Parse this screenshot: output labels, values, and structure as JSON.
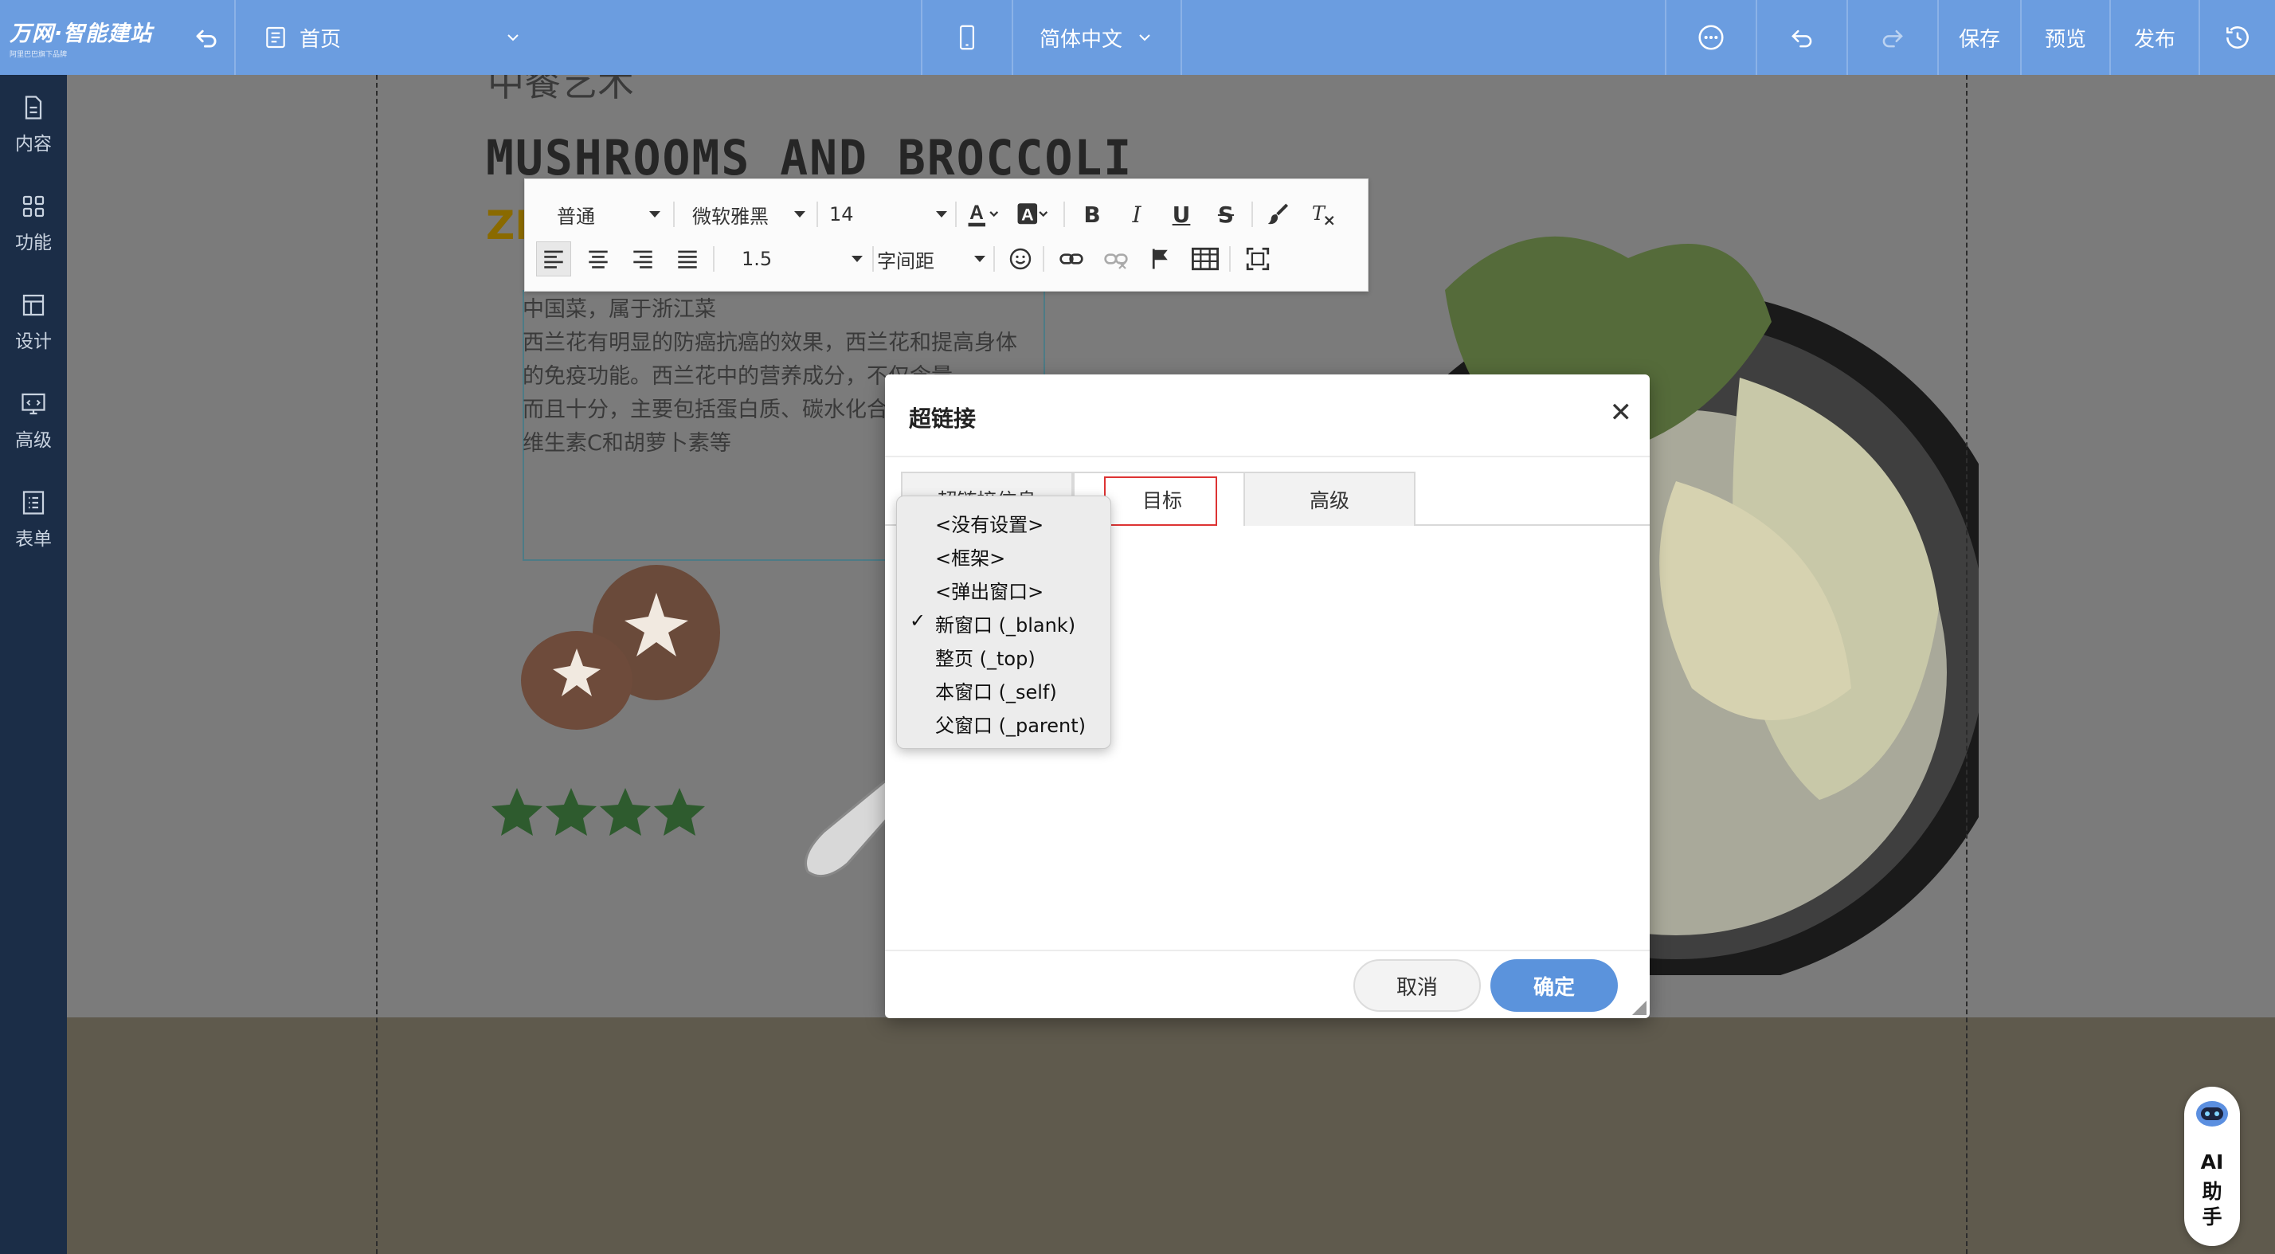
{
  "topbar": {
    "brand": "万网·智能建站",
    "brand_tagline": "阿里巴巴旗下品牌",
    "page_selector": "首页",
    "language": "简体中文",
    "save": "保存",
    "preview": "预览",
    "publish": "发布"
  },
  "sidebar": {
    "items": [
      {
        "label": "内容",
        "icon": "document-icon"
      },
      {
        "label": "功能",
        "icon": "grid-icon"
      },
      {
        "label": "设计",
        "icon": "layout-icon"
      },
      {
        "label": "高级",
        "icon": "code-monitor-icon"
      },
      {
        "label": "表单",
        "icon": "list-form-icon"
      }
    ]
  },
  "canvas": {
    "cuisine_title": "中餐艺术",
    "dish_heading": "MUSHROOMS AND BROCCOLI",
    "dish_sub": "ZH",
    "description_lines": [
      "中国菜，属于浙江菜",
      "西兰花有明显的防癌抗癌的效果，西兰花和提高身体",
      "的免疫功能。西兰花中的营养成分，不仅含量",
      "而且十分，主要包括蛋白质、碳水化合",
      "维生素C和胡萝卜素等"
    ],
    "rating_stars": 4
  },
  "editor_toolbar": {
    "paragraph_format": "普通",
    "font_family": "微软雅黑",
    "font_size": "14",
    "line_height": "1.5",
    "letter_spacing": "字间距"
  },
  "dialog": {
    "title": "超链接",
    "tabs": [
      "超链接信息",
      "目标",
      "高级"
    ],
    "active_tab": "目标",
    "cancel": "取消",
    "confirm": "确定"
  },
  "target_dropdown": {
    "options": [
      "<没有设置>",
      "<框架>",
      "<弹出窗口>",
      "新窗口 (_blank)",
      "整页 (_top)",
      "本窗口 (_self)",
      "父窗口 (_parent)"
    ],
    "selected": "新窗口 (_blank)",
    "check_mark": "✓"
  },
  "ai_assistant": {
    "line1": "AI",
    "line2": "助",
    "line3": "手"
  },
  "colors": {
    "topbar": "#6b9de0",
    "sidebar": "#1b2d47",
    "primary_button": "#5b93dc",
    "star": "#2e5b2e",
    "focus_outline": "#dd3333"
  }
}
